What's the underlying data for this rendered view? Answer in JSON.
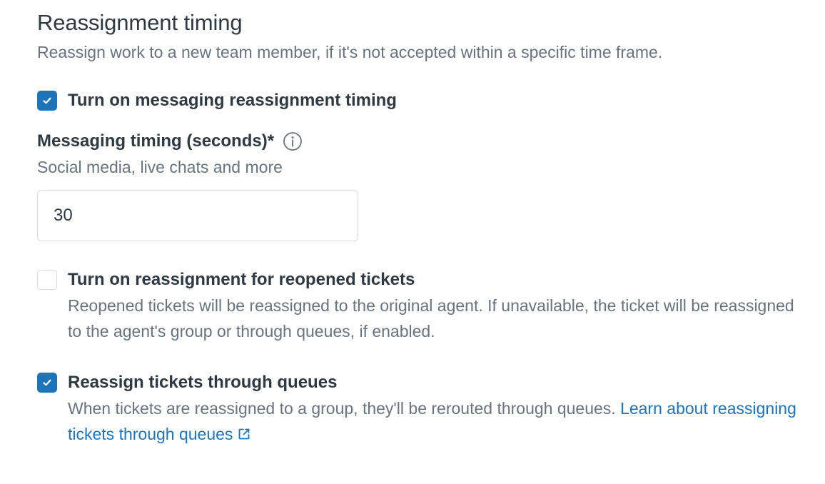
{
  "section": {
    "title": "Reassignment timing",
    "description": "Reassign work to a new team member, if it's not accepted within a specific time frame."
  },
  "messaging_toggle": {
    "label": "Turn on messaging reassignment timing",
    "checked": true
  },
  "messaging_timing": {
    "label": "Messaging timing (seconds)*",
    "hint": "Social media, live chats and more",
    "value": "30",
    "info_icon": "info-circle-icon"
  },
  "reopened_toggle": {
    "label": "Turn on reassignment for reopened tickets",
    "description": "Reopened tickets will be reassigned to the original agent. If unavailable, the ticket will be reassigned to the agent's group or through queues, if enabled.",
    "checked": false
  },
  "queues_toggle": {
    "label": "Reassign tickets through queues",
    "description": "When tickets are reassigned to a group, they'll be rerouted through queues.",
    "link_text": "Learn about reassigning tickets through queues",
    "link_icon": "external-link-icon",
    "checked": true
  },
  "colors": {
    "accent": "#1f73b7",
    "text_primary": "#2f3941",
    "text_secondary": "#68737d",
    "border": "#d8dcde"
  }
}
